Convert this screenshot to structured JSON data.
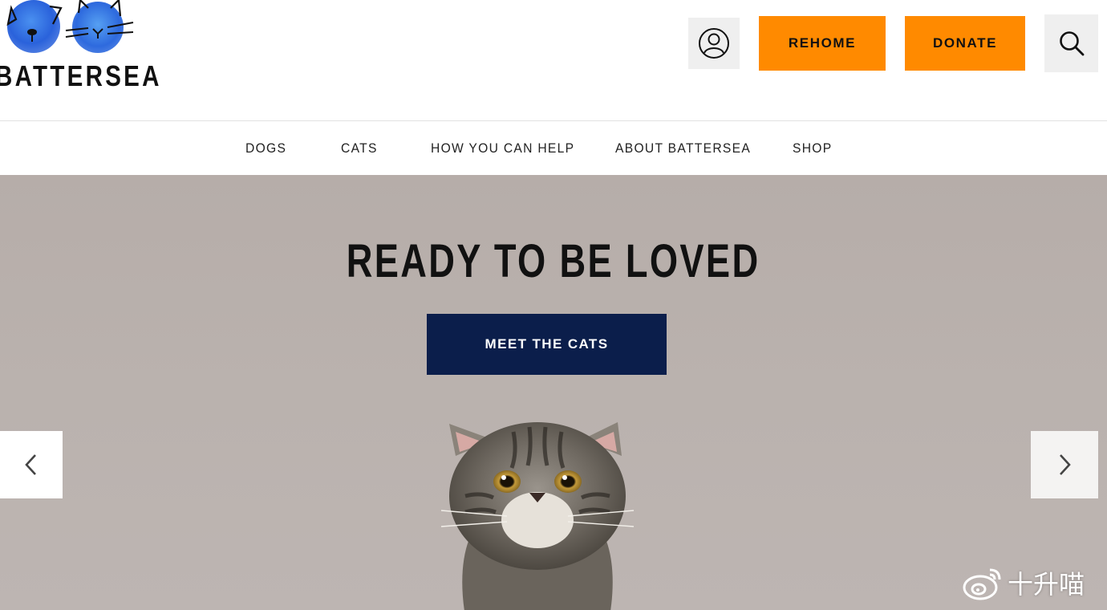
{
  "brand": {
    "name": "BATTERSEA",
    "accent_orange": "#ff8a00",
    "navy": "#0b1e4b",
    "logo_blue": "#2f6fe0"
  },
  "header": {
    "account_icon": "user-circle-icon",
    "rehome_label": "REHOME",
    "donate_label": "DONATE",
    "search_icon": "search-icon"
  },
  "nav": {
    "items": [
      {
        "label": "DOGS"
      },
      {
        "label": "CATS"
      },
      {
        "label": "HOW YOU CAN HELP"
      },
      {
        "label": "ABOUT BATTERSEA"
      },
      {
        "label": "SHOP"
      }
    ]
  },
  "hero": {
    "title": "READY TO BE LOVED",
    "cta_label": "MEET THE CATS",
    "prev_icon": "chevron-left-icon",
    "next_icon": "chevron-right-icon",
    "image": "tabby-cat-looking-up"
  },
  "watermark": {
    "icon": "weibo-icon",
    "text": "十升喵"
  }
}
